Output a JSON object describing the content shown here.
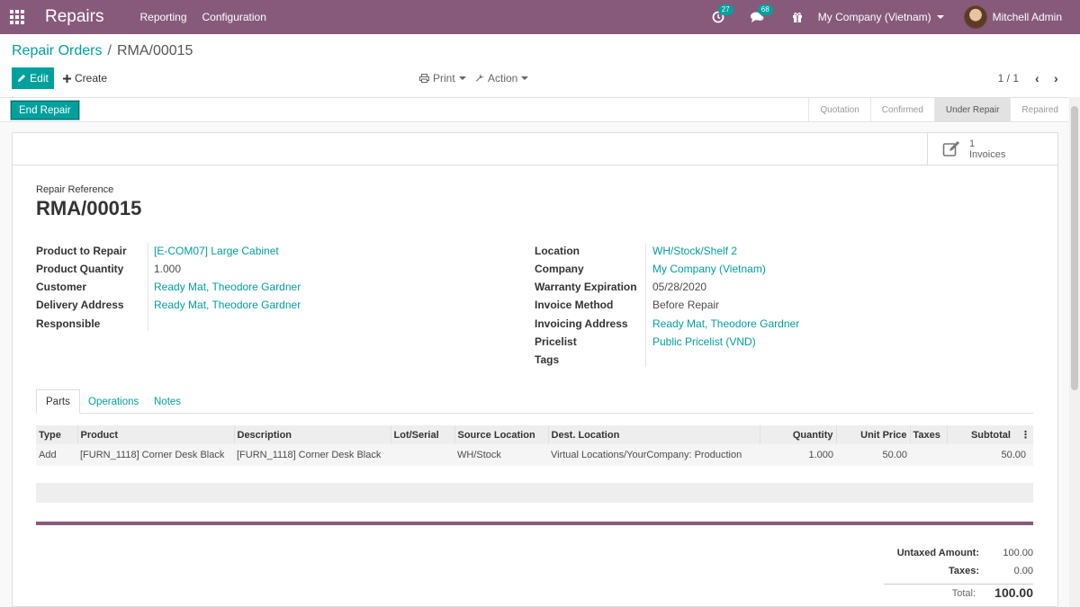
{
  "navbar": {
    "app_title": "Repairs",
    "menu": [
      "Reporting",
      "Configuration"
    ],
    "activity_badge": "27",
    "messages_badge": "68",
    "company": "My Company (Vietnam)",
    "user": "Mitchell Admin"
  },
  "breadcrumb": {
    "parent": "Repair Orders",
    "separator": "/",
    "current": "RMA/00015"
  },
  "toolbar": {
    "edit_label": "Edit",
    "create_label": "Create",
    "print_label": "Print",
    "action_label": "Action",
    "pager": "1 / 1"
  },
  "statusbar": {
    "end_repair_label": "End Repair",
    "stages": [
      "Quotation",
      "Confirmed",
      "Under Repair",
      "Repaired"
    ],
    "active_stage": "Under Repair"
  },
  "smart_button": {
    "count": "1",
    "label": "Invoices"
  },
  "form": {
    "reference_label": "Repair Reference",
    "reference": "RMA/00015",
    "left_fields": [
      {
        "label": "Product to Repair",
        "value": "[E-COM07] Large Cabinet",
        "link": true
      },
      {
        "label": "Product Quantity",
        "value": "1.000",
        "link": false
      },
      {
        "label": "Customer",
        "value": "Ready Mat, Theodore Gardner",
        "link": true
      },
      {
        "label": "Delivery Address",
        "value": "Ready Mat, Theodore Gardner",
        "link": true
      },
      {
        "label": "Responsible",
        "value": "",
        "link": false
      }
    ],
    "right_fields": [
      {
        "label": "Location",
        "value": "WH/Stock/Shelf 2",
        "link": true
      },
      {
        "label": "Company",
        "value": "My Company (Vietnam)",
        "link": true
      },
      {
        "label": "Warranty Expiration",
        "value": "05/28/2020",
        "link": false
      },
      {
        "label": "Invoice Method",
        "value": "Before Repair",
        "link": false
      },
      {
        "label": "Invoicing Address",
        "value": "Ready Mat, Theodore Gardner",
        "link": true
      },
      {
        "label": "Pricelist",
        "value": "Public Pricelist (VND)",
        "link": true
      },
      {
        "label": "Tags",
        "value": "",
        "link": false
      }
    ]
  },
  "tabs": [
    "Parts",
    "Operations",
    "Notes"
  ],
  "active_tab": "Parts",
  "parts_table": {
    "columns": [
      "Type",
      "Product",
      "Description",
      "Lot/Serial",
      "Source Location",
      "Dest. Location",
      "Quantity",
      "Unit Price",
      "Taxes",
      "Subtotal"
    ],
    "rows": [
      {
        "type": "Add",
        "product": "[FURN_1118] Corner Desk Black",
        "description": "[FURN_1118] Corner Desk Black",
        "lot": "",
        "source": "WH/Stock",
        "dest": "Virtual Locations/YourCompany: Production",
        "quantity": "1.000",
        "unit_price": "50.00",
        "taxes": "",
        "subtotal": "50.00"
      }
    ]
  },
  "totals": {
    "untaxed_label": "Untaxed Amount:",
    "untaxed_value": "100.00",
    "taxes_label": "Taxes:",
    "taxes_value": "0.00",
    "total_label": "Total:",
    "total_value": "100.00"
  },
  "colors": {
    "brand": "#875a7b",
    "accent": "#00a09d"
  }
}
